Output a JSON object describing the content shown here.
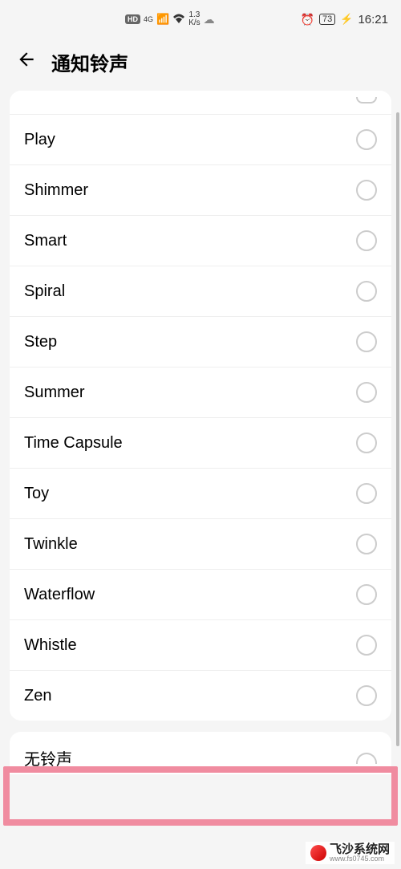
{
  "status_bar": {
    "hd": "HD",
    "network_type": "4G",
    "net_speed_value": "1.3",
    "net_speed_unit": "K/s",
    "battery": "73",
    "time": "16:21"
  },
  "header": {
    "title": "通知铃声"
  },
  "ringtones": [
    {
      "label": "Play",
      "selected": false
    },
    {
      "label": "Shimmer",
      "selected": false
    },
    {
      "label": "Smart",
      "selected": false
    },
    {
      "label": "Spiral",
      "selected": false
    },
    {
      "label": "Step",
      "selected": false
    },
    {
      "label": "Summer",
      "selected": false
    },
    {
      "label": "Time Capsule",
      "selected": false
    },
    {
      "label": "Toy",
      "selected": false
    },
    {
      "label": "Twinkle",
      "selected": false
    },
    {
      "label": "Waterflow",
      "selected": false
    },
    {
      "label": "Whistle",
      "selected": false
    },
    {
      "label": "Zen",
      "selected": false
    }
  ],
  "no_sound": {
    "label": "无铃声"
  },
  "watermark": {
    "name": "飞沙系统网",
    "url": "www.fs0745.com"
  }
}
